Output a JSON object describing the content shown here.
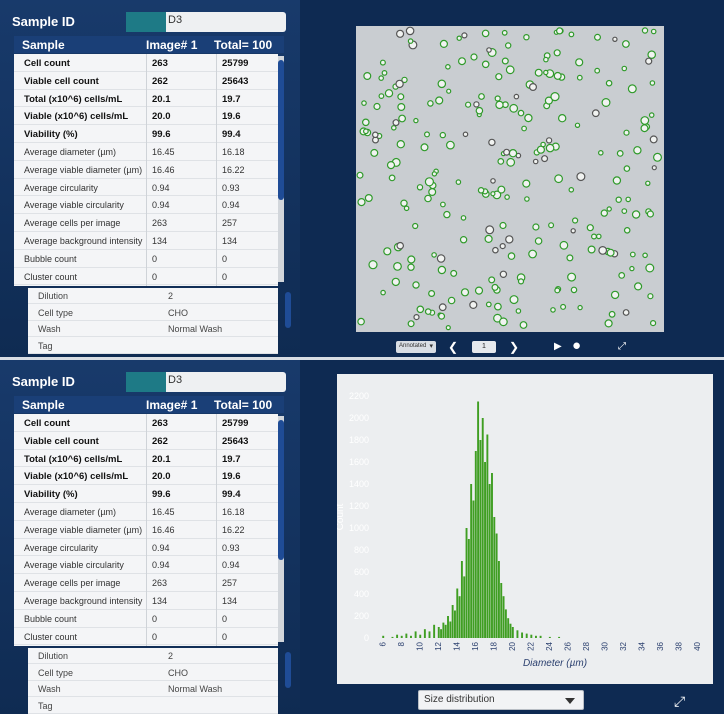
{
  "sample_id": {
    "label": "Sample ID",
    "value": "D3"
  },
  "results_table": {
    "header": {
      "sample": "Sample",
      "image": "Image# 1",
      "total": "Total= 100"
    },
    "rows": [
      {
        "label": "Cell count",
        "image": "263",
        "total": "25799",
        "bold": true
      },
      {
        "label": "Viable cell count",
        "image": "262",
        "total": "25643",
        "bold": true
      },
      {
        "label": "Total (x10^6) cells/mL",
        "image": "20.1",
        "total": "19.7",
        "bold": true
      },
      {
        "label": "Viable (x10^6) cells/mL",
        "image": "20.0",
        "total": "19.6",
        "bold": true
      },
      {
        "label": "Viability (%)",
        "image": "99.6",
        "total": "99.4",
        "bold": true
      },
      {
        "label": "Average diameter (µm)",
        "image": "16.45",
        "total": "16.18",
        "bold": false
      },
      {
        "label": "Average viable diameter (µm)",
        "image": "16.46",
        "total": "16.22",
        "bold": false
      },
      {
        "label": "Average circularity",
        "image": "0.94",
        "total": "0.93",
        "bold": false
      },
      {
        "label": "Average viable circularity",
        "image": "0.94",
        "total": "0.94",
        "bold": false
      },
      {
        "label": "Average cells per image",
        "image": "263",
        "total": "257",
        "bold": false
      },
      {
        "label": "Average background intensity",
        "image": "134",
        "total": "134",
        "bold": false
      },
      {
        "label": "Bubble count",
        "image": "0",
        "total": "0",
        "bold": false
      },
      {
        "label": "Cluster count",
        "image": "0",
        "total": "0",
        "bold": false
      }
    ]
  },
  "sample_info": [
    {
      "label": "Dilution",
      "value": "2"
    },
    {
      "label": "Cell type",
      "value": "CHO"
    },
    {
      "label": "Wash",
      "value": "Normal Wash"
    },
    {
      "label": "Tag",
      "value": ""
    }
  ],
  "image_viewer": {
    "image_type_select": "Annotated",
    "page": "1",
    "icons": [
      "chevron-left-icon",
      "chevron-right-icon",
      "play-icon",
      "circle-icon",
      "expand-icon"
    ]
  },
  "chart_panel": {
    "view_select": "Size distribution",
    "expand_icon": "expand-icon"
  },
  "colors": {
    "panel_bg": "#0f2b52",
    "header_bg": "#1a3f77",
    "bar_color": "#3f9e22",
    "table_bg": "#f4f5f7",
    "highlight": "#1f4c96"
  },
  "chart_data": {
    "type": "bar",
    "xlabel": "Diameter (µm)",
    "ylabel": "Count",
    "xlim": [
      5,
      40
    ],
    "ylim": [
      0,
      2200
    ],
    "yticks": [
      0,
      200,
      400,
      600,
      800,
      1000,
      1200,
      1400,
      1600,
      1800,
      2000,
      2200
    ],
    "xticks": [
      6,
      8,
      10,
      12,
      14,
      16,
      18,
      20,
      22,
      24,
      26,
      28,
      30,
      32,
      34,
      36,
      38,
      40
    ],
    "grid": false,
    "bin_width": 0.25,
    "bins": [
      [
        6.0,
        20
      ],
      [
        7.0,
        10
      ],
      [
        7.5,
        30
      ],
      [
        8.0,
        20
      ],
      [
        8.5,
        40
      ],
      [
        9.0,
        20
      ],
      [
        9.5,
        60
      ],
      [
        10.0,
        30
      ],
      [
        10.5,
        80
      ],
      [
        11.0,
        60
      ],
      [
        11.5,
        120
      ],
      [
        12.0,
        100
      ],
      [
        12.25,
        80
      ],
      [
        12.5,
        140
      ],
      [
        12.75,
        120
      ],
      [
        13.0,
        200
      ],
      [
        13.25,
        150
      ],
      [
        13.5,
        300
      ],
      [
        13.75,
        250
      ],
      [
        14.0,
        450
      ],
      [
        14.25,
        380
      ],
      [
        14.5,
        700
      ],
      [
        14.75,
        560
      ],
      [
        15.0,
        1000
      ],
      [
        15.25,
        900
      ],
      [
        15.5,
        1400
      ],
      [
        15.75,
        1250
      ],
      [
        16.0,
        1700
      ],
      [
        16.25,
        2150
      ],
      [
        16.5,
        1800
      ],
      [
        16.75,
        2000
      ],
      [
        17.0,
        1600
      ],
      [
        17.25,
        1850
      ],
      [
        17.5,
        1400
      ],
      [
        17.75,
        1500
      ],
      [
        18.0,
        1100
      ],
      [
        18.25,
        950
      ],
      [
        18.5,
        700
      ],
      [
        18.75,
        500
      ],
      [
        19.0,
        380
      ],
      [
        19.25,
        260
      ],
      [
        19.5,
        180
      ],
      [
        19.75,
        130
      ],
      [
        20.0,
        100
      ],
      [
        20.5,
        70
      ],
      [
        21.0,
        50
      ],
      [
        21.5,
        40
      ],
      [
        22.0,
        30
      ],
      [
        22.5,
        20
      ],
      [
        23.0,
        20
      ],
      [
        24.0,
        10
      ],
      [
        25.0,
        10
      ]
    ]
  }
}
